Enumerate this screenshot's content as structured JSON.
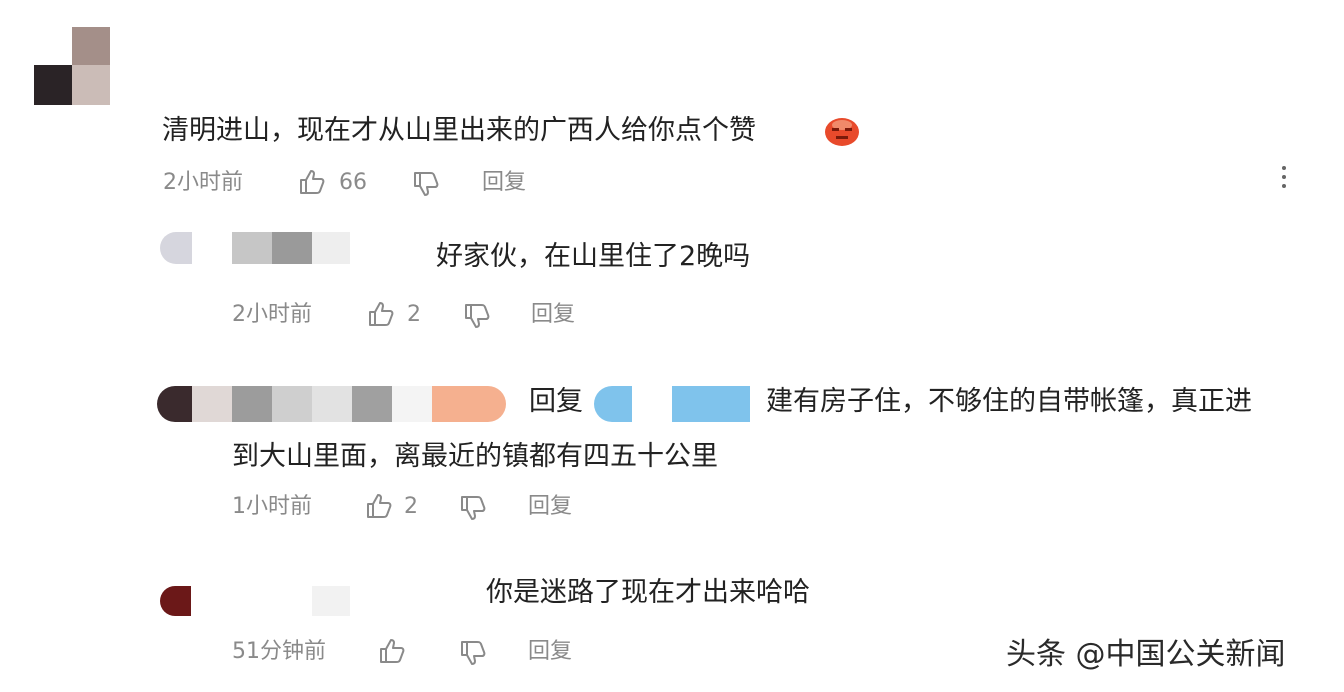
{
  "comments": [
    {
      "text": "清明进山，现在才从山里出来的广西人给你点个赞",
      "time": "2小时前",
      "likes": "66",
      "reply_label": "回复"
    }
  ],
  "replies": [
    {
      "text": "好家伙，在山里住了2晚吗",
      "time": "2小时前",
      "likes": "2",
      "reply_label": "回复"
    },
    {
      "reply_prefix": "回复",
      "text_line1": "建有房子住，不够住的自带帐篷，真正进",
      "text_line2": "到大山里面，离最近的镇都有四五十公里",
      "time": "1小时前",
      "likes": "2",
      "reply_label": "回复"
    },
    {
      "text": "你是迷路了现在才出来哈哈",
      "time": "51分钟前",
      "reply_label": "回复"
    }
  ],
  "watermark": "头条 @中国公关新闻",
  "colors": {
    "text": "#222222",
    "meta": "#8a8a8a",
    "mosaic_blue": "#7fc3ec",
    "mosaic_orange": "#f5b08f"
  }
}
